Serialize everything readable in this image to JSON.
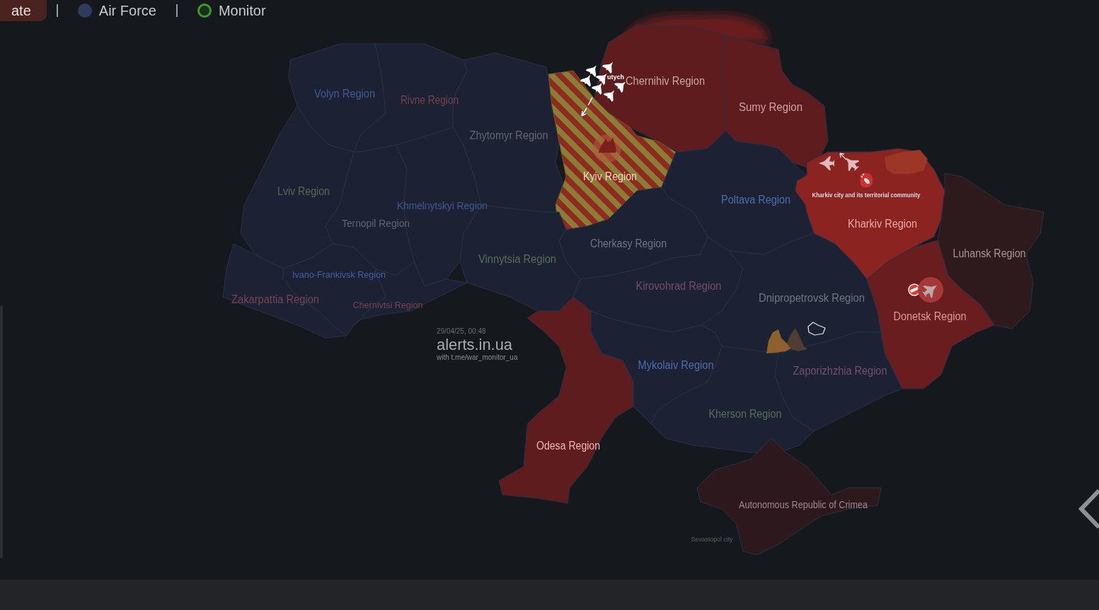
{
  "tabs": [
    {
      "label": "ate",
      "selected": true,
      "kind": "plain"
    },
    {
      "label": "Air Force",
      "selected": false,
      "kind": "dot"
    },
    {
      "label": "Monitor",
      "selected": false,
      "kind": "ring"
    }
  ],
  "map": {
    "regions": [
      {
        "name": "Volyn Region",
        "kind": "solid",
        "color": "#1c2234"
      },
      {
        "name": "Rivne Region",
        "kind": "solid",
        "color": "#1c2234"
      },
      {
        "name": "Zhytomyr Region",
        "kind": "solid",
        "color": "#1c2234"
      },
      {
        "name": "Chernihiv Region",
        "kind": "solid",
        "color": "#5e1c1e"
      },
      {
        "name": "Sumy Region",
        "kind": "solid",
        "color": "#5e1c1e"
      },
      {
        "name": "Kyiv Region",
        "kind": "striped",
        "color": "#8e2a22"
      },
      {
        "name": "Lviv Region",
        "kind": "solid",
        "color": "#1c2234"
      },
      {
        "name": "Khmelnytskyi Region",
        "kind": "solid",
        "color": "#1c2234"
      },
      {
        "name": "Poltava Region",
        "kind": "solid",
        "color": "#1c2234"
      },
      {
        "name": "Ternopil Region",
        "kind": "solid",
        "color": "#1c2234"
      },
      {
        "name": "Kharkiv Region",
        "kind": "solid",
        "color": "#8b2420"
      },
      {
        "name": "Cherkasy Region",
        "kind": "solid",
        "color": "#1c2234"
      },
      {
        "name": "Luhansk Region",
        "kind": "solid",
        "color": "#2e191c"
      },
      {
        "name": "Vinnytsia Region",
        "kind": "solid",
        "color": "#1c2234"
      },
      {
        "name": "Ivano-Frankivsk Region",
        "kind": "solid",
        "color": "#1c2234"
      },
      {
        "name": "Kirovohrad Region",
        "kind": "solid",
        "color": "#1c2234"
      },
      {
        "name": "Zakarpattia Region",
        "kind": "solid",
        "color": "#1c2234"
      },
      {
        "name": "Chernivtsi Region",
        "kind": "solid",
        "color": "#1c2234"
      },
      {
        "name": "Dnipropetrovsk Region",
        "kind": "solid",
        "color": "#1c2234"
      },
      {
        "name": "Donetsk Region",
        "kind": "solid",
        "color": "#6a1d1e"
      },
      {
        "name": "Mykolaiv Region",
        "kind": "solid",
        "color": "#1c2234"
      },
      {
        "name": "Zaporizhzhia Region",
        "kind": "solid",
        "color": "#1c2234"
      },
      {
        "name": "Kherson Region",
        "kind": "solid",
        "color": "#1c2234"
      },
      {
        "name": "Odesa Region",
        "kind": "solid",
        "color": "#5e1c1e"
      },
      {
        "name": "Autonomous Republic of Crimea",
        "kind": "solid",
        "color": "#2d191d"
      }
    ],
    "places": [
      {
        "name": "utych"
      },
      {
        "name": "Kharkiv city and its territorial community"
      },
      {
        "name": "Sevastopol city"
      }
    ],
    "caption": {
      "timestamp": "29/04/25, 00:48",
      "source": "alerts.in.ua",
      "credit": "with t.me/war_monitor_ua"
    }
  }
}
